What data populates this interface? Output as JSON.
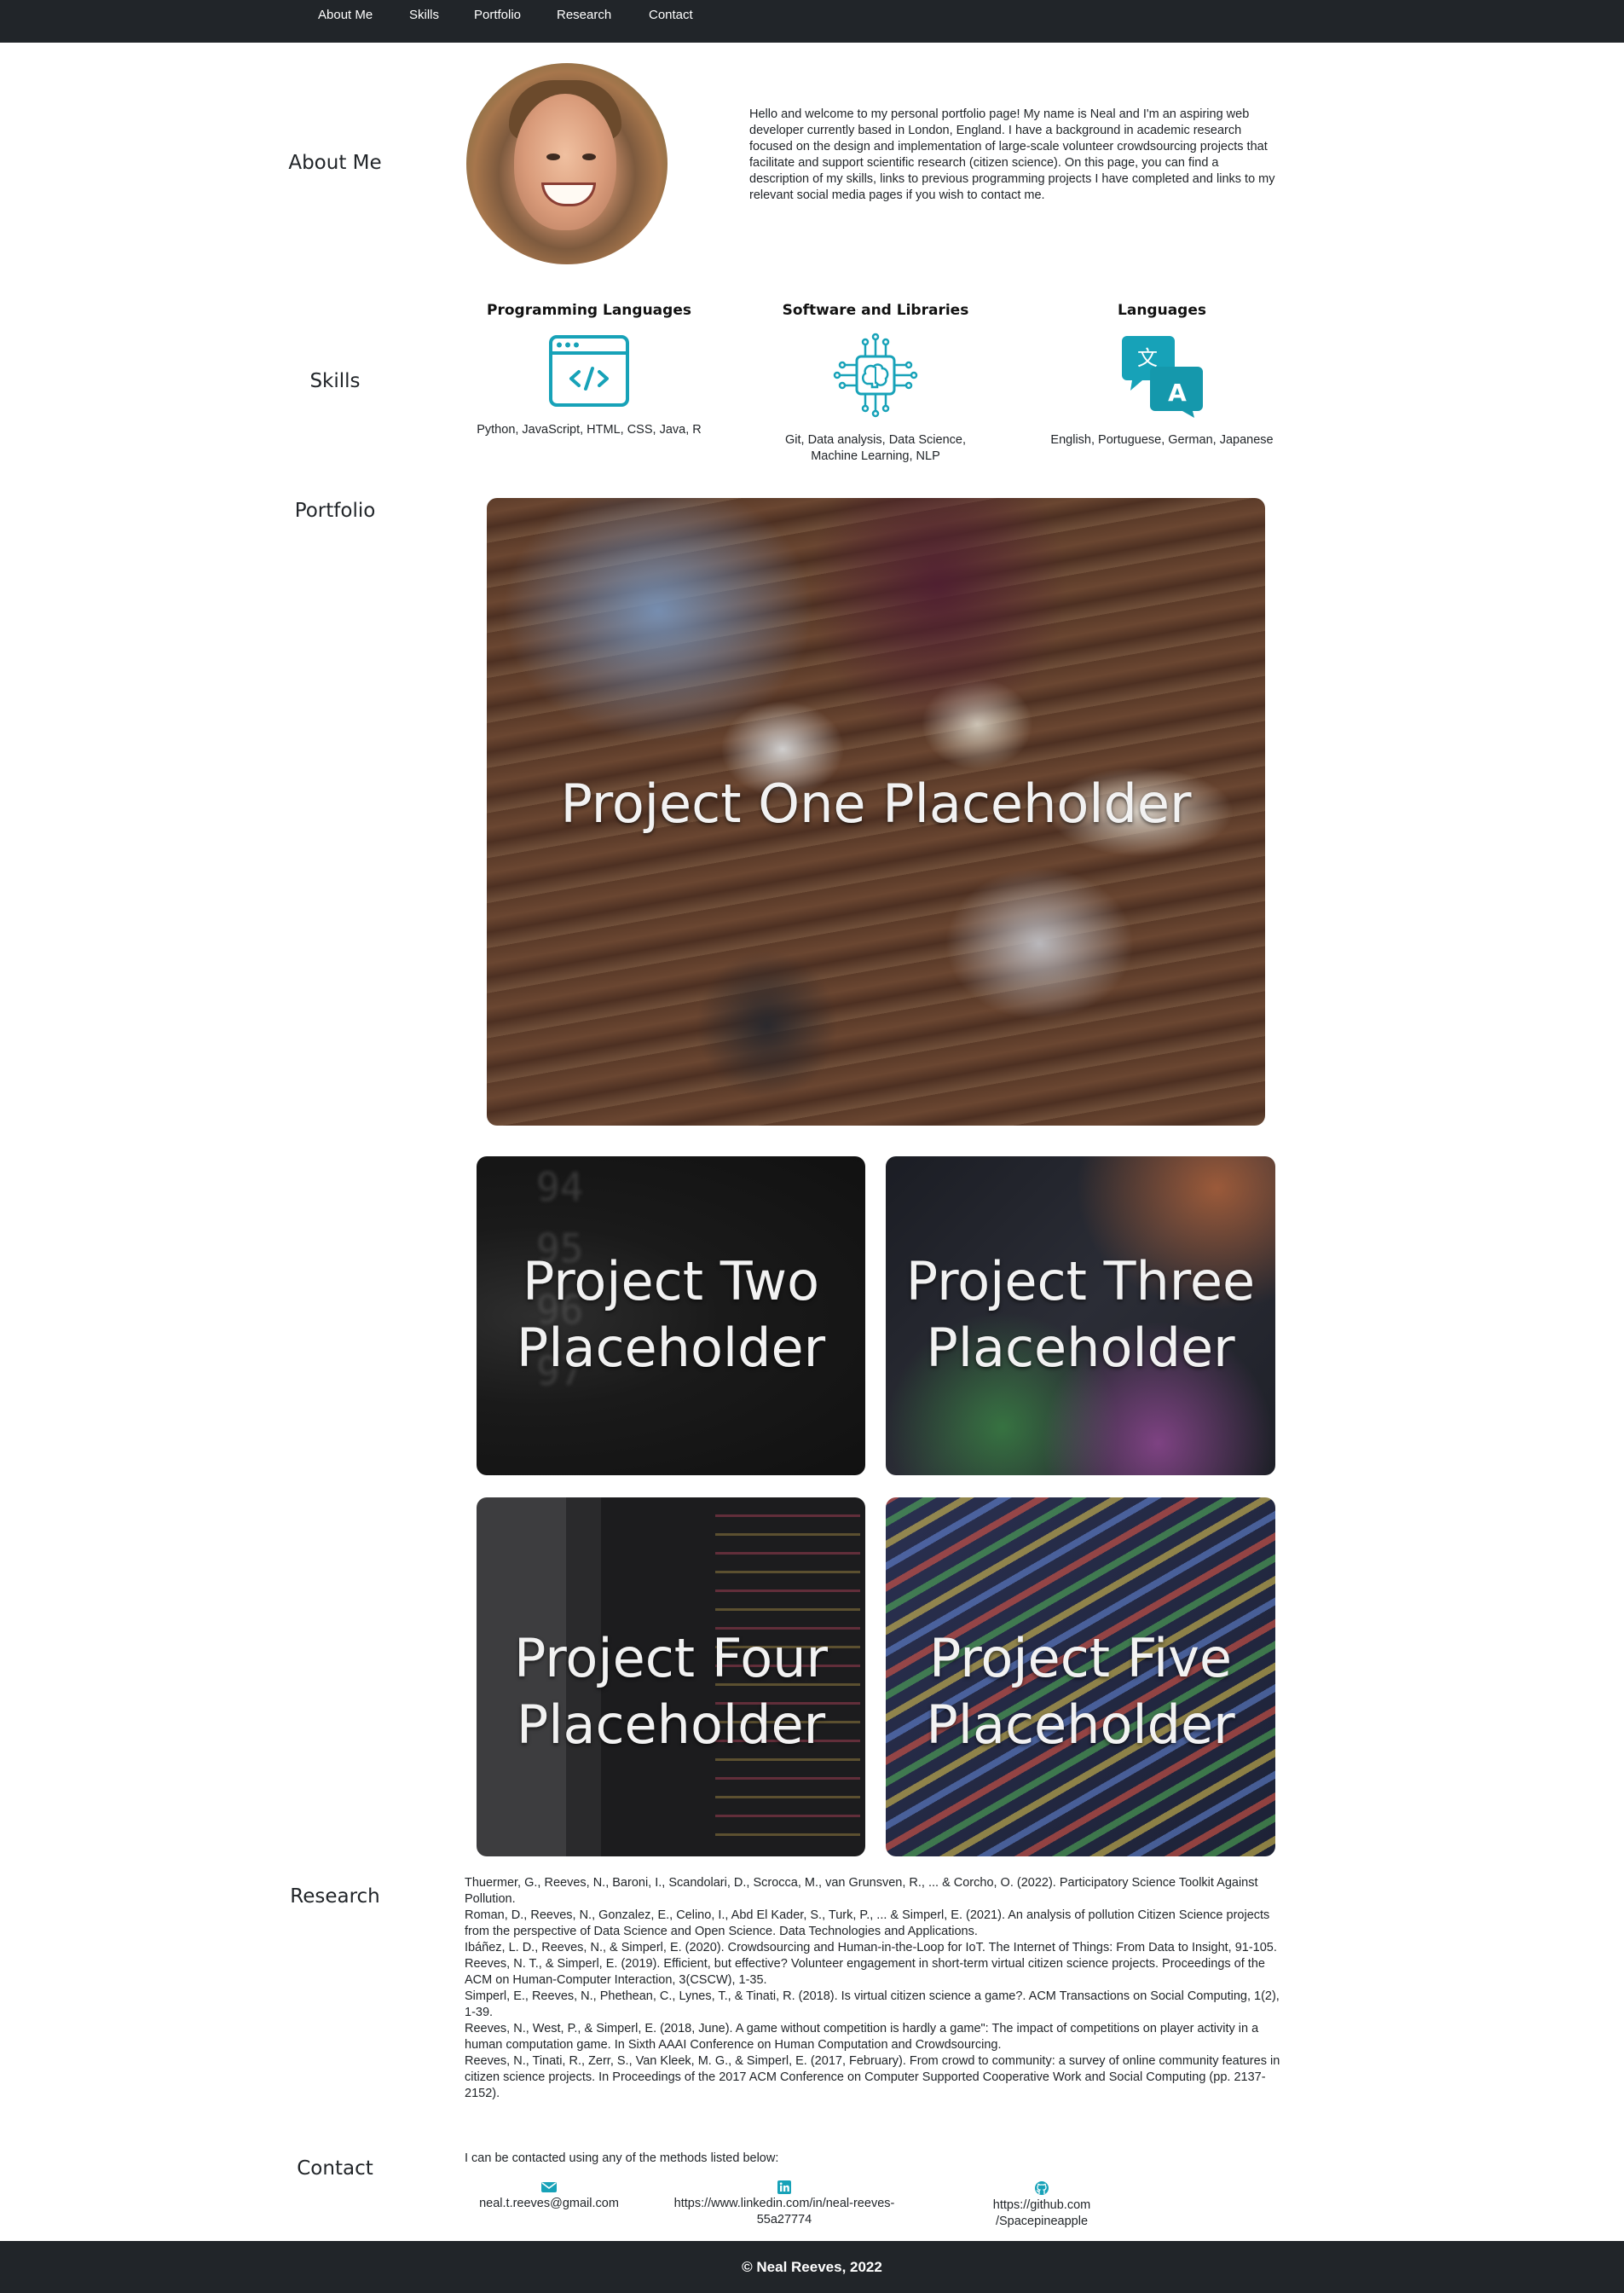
{
  "nav": {
    "items": [
      "About Me",
      "Skills",
      "Portfolio",
      "Research",
      "Contact"
    ]
  },
  "about": {
    "title": "About Me",
    "text": "Hello and welcome to my personal portfolio page! My name is Neal and I'm an aspiring web developer currently based in London, England. I have a background in academic research focused on the design and implementation of large-scale volunteer crowdsourcing projects that facilitate and support scientific research (citizen science). On this page, you can find a description of my skills, links to previous programming projects I have completed and links to my relevant social media pages if you wish to contact me."
  },
  "skills": {
    "title": "Skills",
    "items": [
      {
        "heading": "Programming Languages",
        "desc": "Python, JavaScript, HTML, CSS, Java, R",
        "icon": "code-window-icon"
      },
      {
        "heading": "Software and Libraries",
        "desc": "Git, Data analysis, Data Science, Machine Learning, NLP",
        "icon": "ai-chip-icon"
      },
      {
        "heading": "Languages",
        "desc": "English, Portuguese, German, Japanese",
        "icon": "translate-icon"
      }
    ]
  },
  "portfolio": {
    "title": "Portfolio",
    "projects": [
      {
        "l1": "Project One Placeholder"
      },
      {
        "l1": "Project Two",
        "l2": "Placeholder"
      },
      {
        "l1": "Project Three",
        "l2": "Placeholder"
      },
      {
        "l1": "Project Four",
        "l2": "Placeholder"
      },
      {
        "l1": "Project Five",
        "l2": "Placeholder"
      }
    ]
  },
  "research": {
    "title": "Research",
    "refs": [
      "Thuermer, G., Reeves, N., Baroni, I., Scandolari, D., Scrocca, M., van Grunsven, R., ... & Corcho, O. (2022). Participatory Science Toolkit Against Pollution.",
      "Roman, D., Reeves, N., Gonzalez, E., Celino, I., Abd El Kader, S., Turk, P., ... & Simperl, E. (2021). An analysis of pollution Citizen Science projects from the perspective of Data Science and Open Science. Data Technologies and Applications.",
      "Ibáñez, L. D., Reeves, N., & Simperl, E. (2020). Crowdsourcing and Human-in-the-Loop for IoT. The Internet of Things: From Data to Insight, 91-105.",
      "Reeves, N. T., & Simperl, E. (2019). Efficient, but effective? Volunteer engagement in short-term virtual citizen science projects. Proceedings of the ACM on Human-Computer Interaction, 3(CSCW), 1-35.",
      "Simperl, E., Reeves, N., Phethean, C., Lynes, T., & Tinati, R. (2018). Is virtual citizen science a game?. ACM Transactions on Social Computing, 1(2), 1-39.",
      "Reeves, N., West, P., & Simperl, E. (2018, June). A game without competition is hardly a game\": The impact of competitions on player activity in a human computation game. In Sixth AAAI Conference on Human Computation and Crowdsourcing.",
      "Reeves, N., Tinati, R., Zerr, S., Van Kleek, M. G., & Simperl, E. (2017, February). From crowd to community: a survey of online community features in citizen science projects. In Proceedings of the 2017 ACM Conference on Computer Supported Cooperative Work and Social Computing (pp. 2137-2152)."
    ]
  },
  "contact": {
    "title": "Contact",
    "intro": "I can be contacted using any of the methods listed below:",
    "email": "neal.t.reeves@gmail.com",
    "linkedin_1": "https://www.linkedin.com/in/neal-reeves-",
    "linkedin_2": "55a27774",
    "github_1": "https://github.com",
    "github_2": "/Spacepineapple"
  },
  "footer": {
    "text": "© Neal Reeves, 2022"
  },
  "colors": {
    "nav_bg": "#212529",
    "accent": "#17a2b8",
    "footer_bg": "#212529"
  }
}
